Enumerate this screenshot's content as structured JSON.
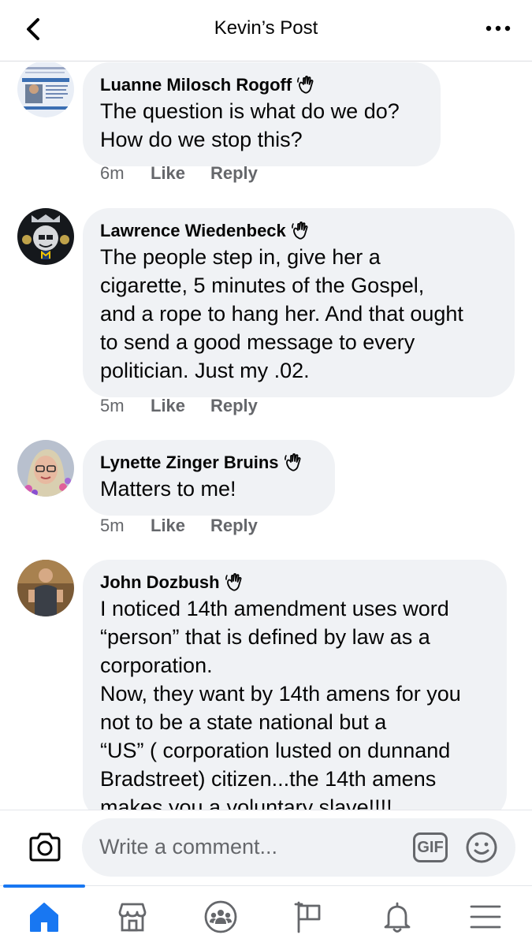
{
  "header": {
    "title": "Kevin’s Post"
  },
  "comments": [
    {
      "author": "Luanne Milosch Rogoff",
      "text": "The question is what do we do?\nHow do we stop this?",
      "time": "6m",
      "like": "Like",
      "reply": "Reply"
    },
    {
      "author": "Lawrence Wiedenbeck",
      "text": "The people step in, give her a\ncigarette, 5 minutes of the Gospel,\nand a rope to hang her. And that ought\nto send a good message to every\npolitician. Just my .02.",
      "time": "5m",
      "like": "Like",
      "reply": "Reply"
    },
    {
      "author": "Lynette Zinger Bruins",
      "text": "Matters to me!",
      "time": "5m",
      "like": "Like",
      "reply": "Reply"
    },
    {
      "author": "John Dozbush",
      "text": "I noticed 14th amendment uses word\n“person” that is defined by law as a\ncorporation.\nNow, they want by 14th amens for you\nnot to be a state national but a\n“US” ( corporation lusted on dunnand\nBradstreet) citizen...the 14th amens\nmakes you a voluntary slave!!!!"
    }
  ],
  "composer": {
    "placeholder": "Write a comment...",
    "gif_label": "GIF"
  },
  "tabbar": {
    "active": "home",
    "tabs": [
      "home",
      "marketplace",
      "groups",
      "pages",
      "notifications",
      "menu"
    ]
  },
  "colors": {
    "accent": "#1877f2",
    "bubble": "#f0f2f5",
    "secondary_text": "#65676b"
  }
}
